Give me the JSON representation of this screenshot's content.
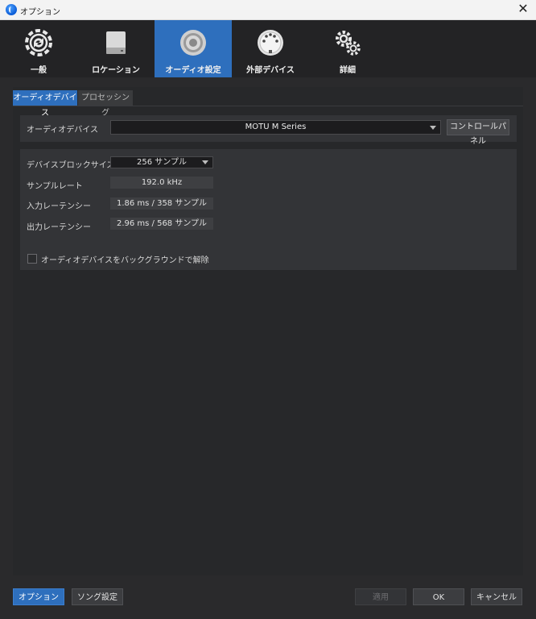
{
  "window": {
    "title": "オプション",
    "close_glyph": "✕"
  },
  "categories": [
    {
      "label": "一般",
      "icon": "gear-refresh-icon"
    },
    {
      "label": "ロケーション",
      "icon": "drive-icon"
    },
    {
      "label": "オーディオ設定",
      "icon": "speaker-icon",
      "active": true
    },
    {
      "label": "外部デバイス",
      "icon": "midi-port-icon"
    },
    {
      "label": "詳細",
      "icon": "gears-icon"
    }
  ],
  "sub_tabs": [
    {
      "label": "オーディオデバイス",
      "active": true
    },
    {
      "label": "プロセッシング",
      "active": false
    }
  ],
  "device": {
    "label": "オーディオデバイス",
    "value": "MOTU M Series",
    "control_panel_label": "コントロールパネル"
  },
  "settings": {
    "block_size_label": "デバイスブロックサイズ",
    "block_size_value": "256 サンプル",
    "sample_rate_label": "サンプルレート",
    "sample_rate_value": "192.0 kHz",
    "input_latency_label": "入力レーテンシー",
    "input_latency_value": "1.86 ms / 358 サンプル",
    "output_latency_label": "出力レーテンシー",
    "output_latency_value": "2.96 ms / 568 サンプル",
    "release_background_label": "オーディオデバイスをバックグラウンドで解除",
    "release_background_checked": false
  },
  "footer": {
    "options_label": "オプション",
    "song_settings_label": "ソング設定",
    "apply_label": "適用",
    "ok_label": "OK",
    "cancel_label": "キャンセル"
  },
  "colors": {
    "accent": "#2e6fbd",
    "background": "#2a2a2c",
    "panel": "#333437"
  }
}
